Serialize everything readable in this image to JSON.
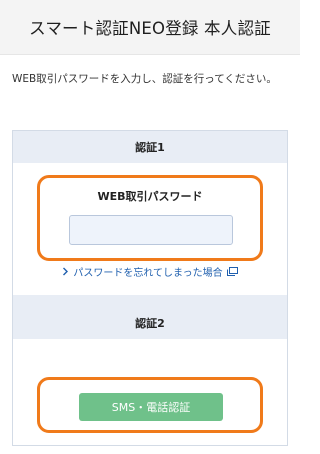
{
  "header": {
    "title": "スマート認証NEO登録 本人認証"
  },
  "instruction": "WEB取引パスワードを入力し、認証を行ってください。",
  "section1": {
    "title": "認証1",
    "password_label": "WEB取引パスワード",
    "password_value": "",
    "forgot_link": "パスワードを忘れてしまった場合",
    "forgot_icon": "external-window-icon"
  },
  "section2": {
    "title": "認証2",
    "sms_button": "SMS・電話認証"
  },
  "colors": {
    "accent_orange": "#f07a1a",
    "button_green": "#6fc18a",
    "section_bg": "#e8edf5",
    "link_blue": "#1f5fae"
  }
}
